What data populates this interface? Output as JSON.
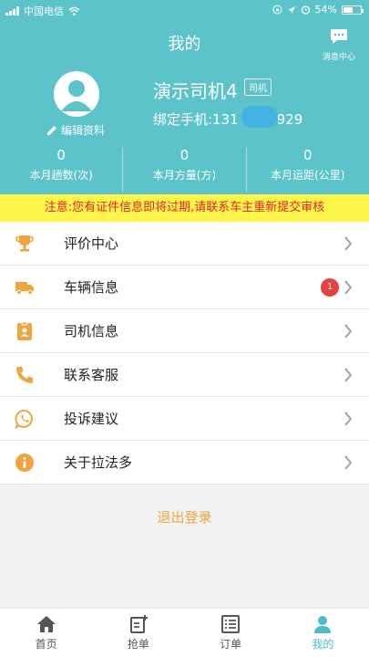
{
  "status_bar": {
    "carrier": "中国电信",
    "battery": "54%",
    "battery_level": 0.54
  },
  "header": {
    "title": "我的",
    "message_center_label": "消息中心",
    "edit_profile_label": "编辑资料",
    "driver_name": "演示司机4",
    "role_tag": "司机",
    "phone_label": "绑定手机:131",
    "phone_suffix": "929"
  },
  "stats": [
    {
      "value": "0",
      "label": "本月趟数(次)"
    },
    {
      "value": "0",
      "label": "本月方量(方)"
    },
    {
      "value": "0",
      "label": "本月运距(公里)"
    }
  ],
  "notice": "注意:您有证件信息即将过期,请联系车主重新提交审核",
  "menu": [
    {
      "icon": "trophy-icon",
      "label": "评价中心"
    },
    {
      "icon": "truck-icon",
      "label": "车辆信息",
      "badge": "1"
    },
    {
      "icon": "id-card-icon",
      "label": "司机信息"
    },
    {
      "icon": "phone-icon",
      "label": "联系客服"
    },
    {
      "icon": "whatsapp-chat-icon",
      "label": "投诉建议"
    },
    {
      "icon": "info-icon",
      "label": "关于拉法多"
    }
  ],
  "logout_label": "退出登录",
  "tabs": [
    {
      "icon": "home-icon",
      "label": "首页"
    },
    {
      "icon": "grab-order-icon",
      "label": "抢单"
    },
    {
      "icon": "order-list-icon",
      "label": "订单"
    },
    {
      "icon": "user-icon",
      "label": "我的",
      "active": true
    }
  ],
  "colors": {
    "header_bg": "#5bc3c9",
    "notice_bg": "#fdf54a",
    "notice_text": "#e0242d",
    "accent": "#f1a43b",
    "active_tab": "#4bbcc5"
  }
}
